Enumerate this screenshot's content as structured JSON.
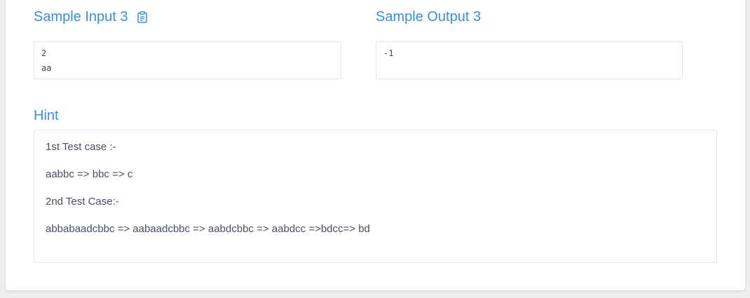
{
  "sample_input": {
    "title": "Sample Input 3",
    "lines": [
      "2",
      "aa"
    ]
  },
  "sample_output": {
    "title": "Sample Output 3",
    "lines": [
      "-1"
    ]
  },
  "hint": {
    "title": "Hint",
    "lines": [
      "1st Test case :-",
      "aabbc => bbc => c",
      "2nd Test Case:-",
      "abbabaadcbbc => aabaadcbbc => aabdcbbc => aabdcc =>bdcc=> bd"
    ]
  },
  "icons": {
    "copy": "clipboard-icon"
  },
  "colors": {
    "accent": "#3b8ed8",
    "text": "#495060",
    "border": "#e4e4e4",
    "background": "#eeeeee"
  }
}
